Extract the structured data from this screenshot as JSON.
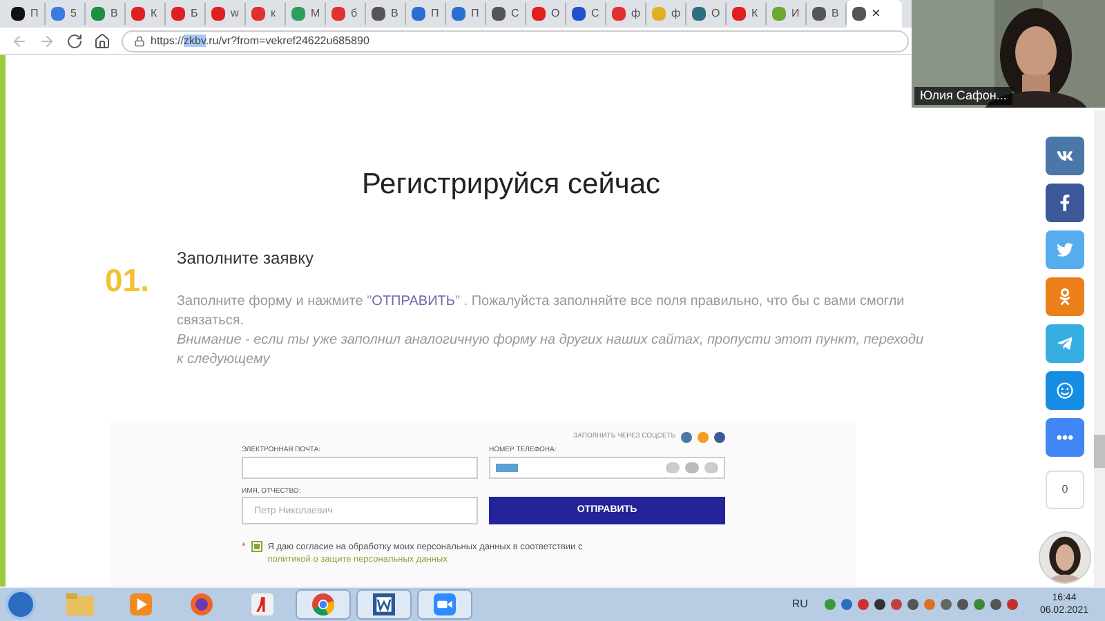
{
  "browser": {
    "tabs": [
      {
        "label": "П",
        "color": "#111111",
        "selected": false
      },
      {
        "label": "5",
        "color": "#3b7be0",
        "selected": false
      },
      {
        "label": "В",
        "color": "#1e8e3e",
        "selected": false
      },
      {
        "label": "К",
        "color": "#e02020",
        "selected": false
      },
      {
        "label": "Б",
        "color": "#e02020",
        "selected": false
      },
      {
        "label": "w",
        "color": "#e02020",
        "selected": false
      },
      {
        "label": "к",
        "color": "#e03030",
        "selected": false
      },
      {
        "label": "М",
        "color": "#2e9e5e",
        "selected": false
      },
      {
        "label": "б",
        "color": "#e03030",
        "selected": false
      },
      {
        "label": "В",
        "color": "#555555",
        "selected": false
      },
      {
        "label": "П",
        "color": "#2a6fd0",
        "selected": false
      },
      {
        "label": "П",
        "color": "#2a6fd0",
        "selected": false
      },
      {
        "label": "С",
        "color": "#555555",
        "selected": false
      },
      {
        "label": "О",
        "color": "#e02020",
        "selected": false
      },
      {
        "label": "С",
        "color": "#2050d0",
        "selected": false
      },
      {
        "label": "ф",
        "color": "#e03030",
        "selected": false
      },
      {
        "label": "ф",
        "color": "#e0b020",
        "selected": false
      },
      {
        "label": "О",
        "color": "#2a7080",
        "selected": false
      },
      {
        "label": "К",
        "color": "#e02020",
        "selected": false
      },
      {
        "label": "И",
        "color": "#6aa830",
        "selected": false
      },
      {
        "label": "В",
        "color": "#555555",
        "selected": false
      },
      {
        "close": "×",
        "color": "#555555",
        "selected": true
      }
    ],
    "url": {
      "prefix": "https://",
      "selected": "zkbv",
      "suffix": ".ru/vr?from=vekref24622u685890"
    }
  },
  "page": {
    "heading": "Регистрируйся сейчас",
    "step": {
      "number": "01.",
      "title": "Заполните заявку",
      "text_before": "Заполните форму и нажмите \"",
      "highlight": "ОТПРАВИТЬ",
      "text_after": "\" . Пожалуйста заполняйте все поля правильно, что бы с вами смогли связаться.",
      "note": "Внимание -  если ты уже  заполнил аналогичную форму на других наших  сайтах,  пропусти этот пункт, переходи к следующему"
    },
    "form": {
      "social_label": "ЗАПОЛНИТЬ ЧЕРЕЗ СОЦСЕТЬ",
      "social_logins": [
        {
          "color": "#4a76a8"
        },
        {
          "color": "#f39c20"
        },
        {
          "color": "#3b5998"
        }
      ],
      "email_label": "ЭЛЕКТРОННАЯ ПОЧТА:",
      "phone_label": "НОМЕР ТЕЛЕФОНА:",
      "name_label": "ИМЯ, ОТЧЕСТВО:",
      "name_placeholder": "Петр Николаевич",
      "submit": "ОТПРАВИТЬ",
      "required_mark": "*",
      "consent_checked": true,
      "consent_text": "Я даю согласие на обработку моих персональных данных в соответствии с ",
      "consent_link": "политикой о защите персональных данных"
    },
    "share": [
      {
        "kind": "vk",
        "color": "#4a76a8"
      },
      {
        "kind": "facebook",
        "color": "#3b5998"
      },
      {
        "kind": "twitter",
        "color": "#55acee"
      },
      {
        "kind": "ok",
        "color": "#eb7f1a"
      },
      {
        "kind": "telegram",
        "color": "#37aee2"
      },
      {
        "kind": "smile",
        "color": "#168de2"
      },
      {
        "kind": "more",
        "color": "#4285f4"
      }
    ],
    "share_count": "0"
  },
  "video": {
    "name": "Юлия Сафон..."
  },
  "taskbar": {
    "apps": [
      {
        "kind": "folder",
        "open": false
      },
      {
        "kind": "media",
        "open": false
      },
      {
        "kind": "firefox",
        "open": false
      },
      {
        "kind": "yandex",
        "open": false
      },
      {
        "kind": "chrome",
        "open": true
      },
      {
        "kind": "word",
        "open": true
      },
      {
        "kind": "zoom",
        "open": true
      }
    ],
    "language": "RU",
    "time": "16:44",
    "date": "06.02.2021"
  }
}
